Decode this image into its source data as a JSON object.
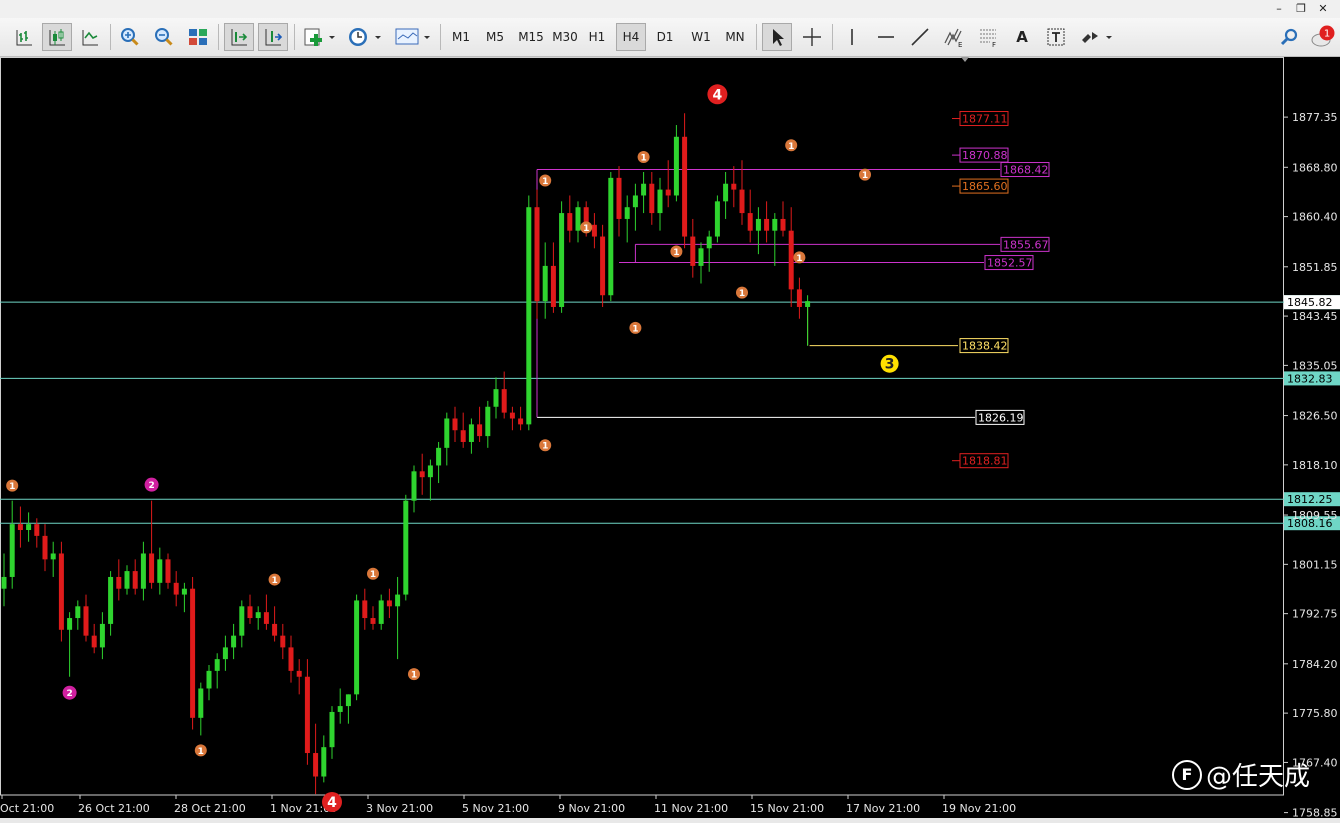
{
  "toolbar": {
    "timeframes": [
      {
        "label": "M1",
        "active": false
      },
      {
        "label": "M5",
        "active": false
      },
      {
        "label": "M15",
        "active": false
      },
      {
        "label": "M30",
        "active": false
      },
      {
        "label": "H1",
        "active": false
      },
      {
        "label": "H4",
        "active": true
      },
      {
        "label": "D1",
        "active": false
      },
      {
        "label": "W1",
        "active": false
      },
      {
        "label": "MN",
        "active": false
      }
    ],
    "text_tool_label": "A",
    "notification_count": "1",
    "icons": [
      "bar-chart-icon",
      "candlestick-chart-icon",
      "line-chart-icon",
      "zoom-in-icon",
      "zoom-out-icon",
      "tile-windows-icon",
      "auto-scroll-icon",
      "chart-shift-icon",
      "indicators-icon",
      "clock-icon",
      "templates-icon",
      "cursor-icon",
      "crosshair-icon",
      "vertical-line-icon",
      "horizontal-line-icon",
      "trendline-icon",
      "elliott-wave-icon",
      "fibonacci-icon",
      "text-label-icon",
      "arrows-icon",
      "search-icon",
      "chat-icon"
    ]
  },
  "watermark": {
    "logo_glyph": "F",
    "text": "@任天成"
  },
  "chart_data": {
    "type": "candlestick",
    "timeframe": "H4",
    "grid": false,
    "background": "#000000",
    "bull_color": "#2fd42f",
    "bear_color": "#e01b1b",
    "price_axis": {
      "range": [
        1761.85,
        1881.8
      ],
      "ticks": [
        "1877.35",
        "1868.80",
        "1860.40",
        "1851.85",
        "1843.45",
        "1835.05",
        "1826.50",
        "1818.10",
        "1809.55",
        "1801.15",
        "1792.75",
        "1784.20",
        "1775.80",
        "1767.40",
        "1758.85"
      ]
    },
    "time_axis": [
      "Oct 21:00",
      "26 Oct 21:00",
      "28 Oct 21:00",
      "1 Nov 21:00",
      "3 Nov 21:00",
      "5 Nov 21:00",
      "9 Nov 21:00",
      "11 Nov 21:00",
      "15 Nov 21:00",
      "17 Nov 21:00",
      "19 Nov 21:00"
    ],
    "candles": [
      [
        1797.0,
        1803.0,
        1794.0,
        1799.0
      ],
      [
        1799.0,
        1812.0,
        1797.0,
        1808.0
      ],
      [
        1808.0,
        1811.0,
        1804.0,
        1807.0
      ],
      [
        1807.0,
        1810.0,
        1805.0,
        1808.0
      ],
      [
        1808.0,
        1809.0,
        1804.0,
        1806.0
      ],
      [
        1806.0,
        1808.0,
        1800.0,
        1802.0
      ],
      [
        1802.0,
        1805.0,
        1799.0,
        1803.0
      ],
      [
        1803.0,
        1805.0,
        1788.0,
        1790.0
      ],
      [
        1790.0,
        1793.0,
        1782.0,
        1792.0
      ],
      [
        1792.0,
        1795.0,
        1790.0,
        1794.0
      ],
      [
        1794.0,
        1796.0,
        1788.0,
        1789.0
      ],
      [
        1789.0,
        1791.0,
        1786.0,
        1787.0
      ],
      [
        1787.0,
        1793.0,
        1785.0,
        1791.0
      ],
      [
        1791.0,
        1800.0,
        1789.0,
        1799.0
      ],
      [
        1799.0,
        1802.0,
        1795.0,
        1797.0
      ],
      [
        1797.0,
        1801.0,
        1796.0,
        1800.0
      ],
      [
        1800.0,
        1802.0,
        1796.0,
        1797.0
      ],
      [
        1797.0,
        1805.0,
        1795.0,
        1803.0
      ],
      [
        1803.0,
        1812.0,
        1797.0,
        1798.0
      ],
      [
        1798.0,
        1804.0,
        1796.0,
        1802.0
      ],
      [
        1802.0,
        1803.0,
        1797.0,
        1798.0
      ],
      [
        1798.0,
        1800.0,
        1794.0,
        1796.0
      ],
      [
        1796.0,
        1798.0,
        1793.0,
        1797.0
      ],
      [
        1797.0,
        1799.0,
        1773.0,
        1775.0
      ],
      [
        1775.0,
        1781.0,
        1772.0,
        1780.0
      ],
      [
        1780.0,
        1784.0,
        1778.0,
        1783.0
      ],
      [
        1783.0,
        1786.0,
        1780.0,
        1785.0
      ],
      [
        1785.0,
        1789.0,
        1783.0,
        1787.0
      ],
      [
        1787.0,
        1791.0,
        1785.0,
        1789.0
      ],
      [
        1789.0,
        1795.0,
        1787.0,
        1794.0
      ],
      [
        1794.0,
        1796.0,
        1791.0,
        1792.0
      ],
      [
        1792.0,
        1794.0,
        1790.0,
        1793.0
      ],
      [
        1793.0,
        1796.0,
        1790.0,
        1791.0
      ],
      [
        1791.0,
        1794.0,
        1788.0,
        1789.0
      ],
      [
        1789.0,
        1791.0,
        1785.0,
        1787.0
      ],
      [
        1787.0,
        1789.0,
        1781.0,
        1783.0
      ],
      [
        1783.0,
        1785.0,
        1779.0,
        1782.0
      ],
      [
        1782.0,
        1785.0,
        1767.0,
        1769.0
      ],
      [
        1769.0,
        1774.0,
        1762.0,
        1765.0
      ],
      [
        1765.0,
        1772.0,
        1764.0,
        1770.0
      ],
      [
        1770.0,
        1777.0,
        1768.0,
        1776.0
      ],
      [
        1776.0,
        1780.0,
        1774.0,
        1777.0
      ],
      [
        1777.0,
        1779.0,
        1774.0,
        1779.0
      ],
      [
        1779.0,
        1796.0,
        1778.0,
        1795.0
      ],
      [
        1795.0,
        1797.0,
        1790.0,
        1792.0
      ],
      [
        1792.0,
        1794.0,
        1790.0,
        1791.0
      ],
      [
        1791.0,
        1796.0,
        1790.0,
        1795.0
      ],
      [
        1795.0,
        1797.0,
        1792.0,
        1794.0
      ],
      [
        1794.0,
        1799.0,
        1785.0,
        1796.0
      ],
      [
        1796.0,
        1813.0,
        1795.0,
        1812.0
      ],
      [
        1812.0,
        1818.0,
        1810.0,
        1817.0
      ],
      [
        1817.0,
        1820.0,
        1813.0,
        1816.0
      ],
      [
        1816.0,
        1819.0,
        1812.0,
        1818.0
      ],
      [
        1818.0,
        1822.0,
        1815.0,
        1821.0
      ],
      [
        1821.0,
        1827.0,
        1818.0,
        1826.0
      ],
      [
        1826.0,
        1828.0,
        1822.0,
        1824.0
      ],
      [
        1824.0,
        1827.0,
        1821.0,
        1822.0
      ],
      [
        1822.0,
        1826.0,
        1820.0,
        1825.0
      ],
      [
        1825.0,
        1828.0,
        1822.0,
        1823.0
      ],
      [
        1823.0,
        1829.0,
        1821.0,
        1828.0
      ],
      [
        1828.0,
        1833.0,
        1826.0,
        1831.0
      ],
      [
        1831.0,
        1834.0,
        1826.0,
        1827.0
      ],
      [
        1827.0,
        1828.0,
        1824.0,
        1826.0
      ],
      [
        1826.0,
        1828.0,
        1824.0,
        1825.0
      ],
      [
        1825.0,
        1864.0,
        1824.0,
        1862.0
      ],
      [
        1862.0,
        1865.0,
        1843.0,
        1846.0
      ],
      [
        1846.0,
        1856.0,
        1843.0,
        1852.0
      ],
      [
        1852.0,
        1856.0,
        1844.0,
        1845.0
      ],
      [
        1845.0,
        1863.0,
        1844.0,
        1861.0
      ],
      [
        1861.0,
        1864.0,
        1856.0,
        1858.0
      ],
      [
        1858.0,
        1863.0,
        1856.0,
        1862.0
      ],
      [
        1862.0,
        1863.0,
        1857.0,
        1859.0
      ],
      [
        1859.0,
        1861.0,
        1855.0,
        1857.0
      ],
      [
        1857.0,
        1859.0,
        1845.0,
        1847.0
      ],
      [
        1847.0,
        1868.0,
        1846.0,
        1867.0
      ],
      [
        1867.0,
        1869.0,
        1857.0,
        1860.0
      ],
      [
        1860.0,
        1864.0,
        1856.0,
        1862.0
      ],
      [
        1862.0,
        1866.0,
        1858.0,
        1864.0
      ],
      [
        1864.0,
        1868.0,
        1861.0,
        1866.0
      ],
      [
        1866.0,
        1868.0,
        1859.0,
        1861.0
      ],
      [
        1861.0,
        1867.0,
        1858.0,
        1865.0
      ],
      [
        1865.0,
        1870.0,
        1862.0,
        1864.0
      ],
      [
        1864.0,
        1876.0,
        1863.0,
        1874.0
      ],
      [
        1874.0,
        1878.0,
        1855.0,
        1857.0
      ],
      [
        1857.0,
        1860.0,
        1850.0,
        1852.0
      ],
      [
        1852.0,
        1856.0,
        1849.0,
        1855.0
      ],
      [
        1855.0,
        1858.0,
        1851.0,
        1857.0
      ],
      [
        1857.0,
        1864.0,
        1856.0,
        1863.0
      ],
      [
        1863.0,
        1868.0,
        1860.0,
        1866.0
      ],
      [
        1866.0,
        1869.0,
        1862.0,
        1865.0
      ],
      [
        1865.0,
        1870.0,
        1859.0,
        1861.0
      ],
      [
        1861.0,
        1865.0,
        1856.0,
        1858.0
      ],
      [
        1858.0,
        1862.0,
        1854.0,
        1860.0
      ],
      [
        1860.0,
        1863.0,
        1856.0,
        1858.0
      ],
      [
        1858.0,
        1861.0,
        1852.0,
        1860.0
      ],
      [
        1860.0,
        1863.0,
        1857.0,
        1858.0
      ],
      [
        1858.0,
        1862.0,
        1845.0,
        1848.0
      ],
      [
        1848.0,
        1850.0,
        1843.0,
        1845.0
      ],
      [
        1845.0,
        1847.0,
        1838.4,
        1846.0
      ]
    ],
    "current_price": "1845.82",
    "horizontal_levels": [
      {
        "price": 1845.82,
        "label": "1845.82",
        "color": "#6fd6c6",
        "style": "axis"
      },
      {
        "price": 1832.83,
        "label": "1832.83",
        "color": "#6fd6c6",
        "style": "axis"
      },
      {
        "price": 1812.25,
        "label": "1812.25",
        "color": "#6fd6c6",
        "style": "axis"
      },
      {
        "price": 1808.16,
        "label": "1808.16",
        "color": "#6fd6c6",
        "style": "axis"
      },
      {
        "price": 1826.19,
        "label": "1826.19",
        "color": "#ffffff",
        "style": "boxed"
      },
      {
        "price": 1868.42,
        "label": "1868.42",
        "color": "#cc33cc",
        "style": "boxed"
      },
      {
        "price": 1855.67,
        "label": "1855.67",
        "color": "#cc33cc",
        "style": "boxed"
      },
      {
        "price": 1852.57,
        "label": "1852.57",
        "color": "#cc33cc",
        "style": "boxed"
      },
      {
        "price": 1838.42,
        "label": "1838.42",
        "color": "#ffe066",
        "style": "boxed"
      }
    ],
    "price_labels": [
      {
        "price": 1877.11,
        "label": "1877.11",
        "color": "#e02020"
      },
      {
        "price": 1870.88,
        "label": "1870.88",
        "color": "#cc33cc"
      },
      {
        "price": 1865.6,
        "label": "1865.60",
        "color": "#e07020"
      },
      {
        "price": 1818.81,
        "label": "1818.81",
        "color": "#e02020"
      }
    ],
    "wave_markers": [
      {
        "label": "1",
        "candle": 1,
        "price": 1812.0,
        "pos": "above",
        "color": "#d9773a"
      },
      {
        "label": "2",
        "candle": 8,
        "price": 1782.0,
        "pos": "below",
        "color": "#d020a0"
      },
      {
        "label": "2",
        "candle": 18,
        "price": 1812.0,
        "pos": "above",
        "color": "#d020a0"
      },
      {
        "label": "1",
        "candle": 24,
        "price": 1772.0,
        "pos": "below",
        "color": "#d9773a"
      },
      {
        "label": "1",
        "candle": 33,
        "price": 1796.0,
        "pos": "above",
        "color": "#d9773a"
      },
      {
        "label": "4",
        "candle": 40,
        "price": 1762.0,
        "pos": "below",
        "color": "#e02020"
      },
      {
        "label": "1",
        "candle": 45,
        "price": 1797.0,
        "pos": "above",
        "color": "#d9773a"
      },
      {
        "label": "1",
        "candle": 50,
        "price": 1785.0,
        "pos": "below",
        "color": "#d9773a"
      },
      {
        "label": "1",
        "candle": 66,
        "price": 1864.0,
        "pos": "above",
        "color": "#d9773a"
      },
      {
        "label": "1",
        "candle": 66,
        "price": 1824.0,
        "pos": "below",
        "color": "#d9773a"
      },
      {
        "label": "1",
        "candle": 71,
        "price": 1856.0,
        "pos": "above",
        "color": "#d9773a"
      },
      {
        "label": "1",
        "candle": 77,
        "price": 1844.0,
        "pos": "below",
        "color": "#d9773a"
      },
      {
        "label": "1",
        "candle": 78,
        "price": 1868.0,
        "pos": "above",
        "color": "#d9773a"
      },
      {
        "label": "1",
        "candle": 82,
        "price": 1857.0,
        "pos": "below",
        "color": "#d9773a"
      },
      {
        "label": "4",
        "candle": 87,
        "price": 1878.0,
        "pos": "above",
        "color": "#e02020"
      },
      {
        "label": "1",
        "candle": 90,
        "price": 1850.0,
        "pos": "below",
        "color": "#d9773a"
      },
      {
        "label": "1",
        "candle": 96,
        "price": 1870.0,
        "pos": "above",
        "color": "#d9773a"
      },
      {
        "label": "1",
        "candle": 97,
        "price": 1856.0,
        "pos": "below",
        "color": "#d9773a"
      },
      {
        "label": "1",
        "candle": 105,
        "price": 1865.0,
        "pos": "above",
        "color": "#d9773a"
      },
      {
        "label": "3",
        "candle": 108,
        "price": 1838.4,
        "pos": "below",
        "color": "#ffe000"
      }
    ]
  }
}
